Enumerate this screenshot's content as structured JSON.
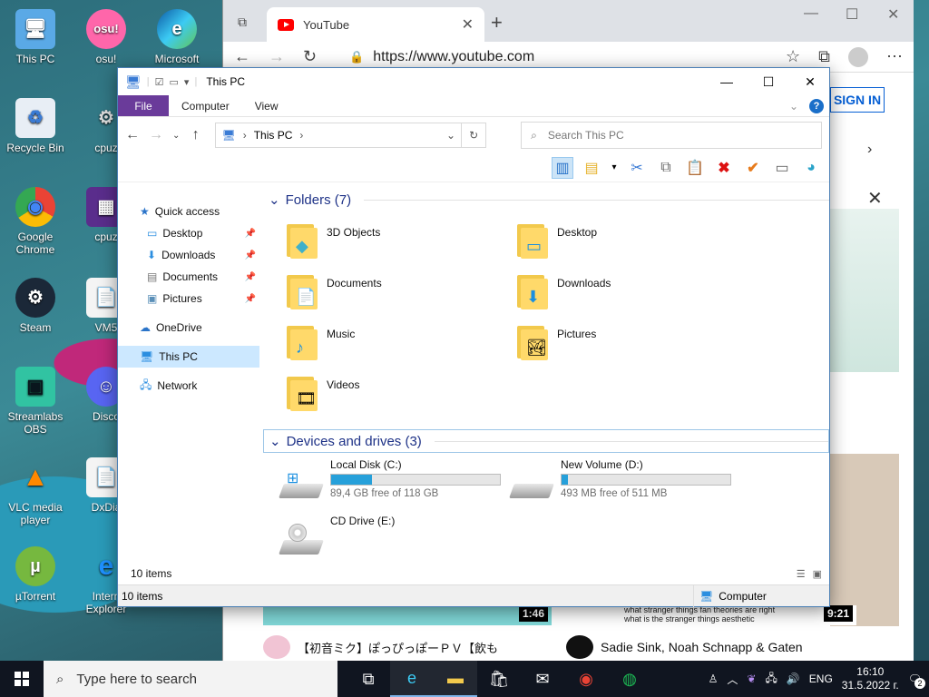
{
  "desktop": {
    "icons": [
      {
        "label": "This PC",
        "glyph": "🖥"
      },
      {
        "label": "Recycle Bin",
        "glyph": "♻"
      },
      {
        "label": "Google Chrome",
        "glyph": "◉"
      },
      {
        "label": "Steam",
        "glyph": "⚙"
      },
      {
        "label": "Streamlabs OBS",
        "glyph": "▣"
      },
      {
        "label": "VLC media player",
        "glyph": "▲"
      },
      {
        "label": "µTorrent",
        "glyph": "µ"
      },
      {
        "label": "osu!",
        "glyph": "osu!"
      },
      {
        "label": "Microsoft",
        "glyph": "e"
      },
      {
        "label": "cpuz",
        "glyph": "⚙"
      },
      {
        "label": "cpuz",
        "glyph": "▦"
      },
      {
        "label": "VM5",
        "glyph": "📄"
      },
      {
        "label": "Disco",
        "glyph": "☺"
      },
      {
        "label": "DxDia",
        "glyph": "📄"
      },
      {
        "label": "Intern Explorer",
        "glyph": "e"
      }
    ]
  },
  "browser": {
    "tab_title": "YouTube",
    "url": "https://www.youtube.com",
    "sign_in": "SIGN IN",
    "video_durations": [
      "1:46",
      "9:21"
    ],
    "video_titles": [
      "【初音ミク】ぽっぴっぽーＰＶ【飲も",
      "Sadie Sink, Noah Schnapp & Gaten"
    ],
    "thumb_caption_1": "what stranger things fan theories are right",
    "thumb_caption_2": "what is the stranger things aesthetic"
  },
  "explorer": {
    "title": "This PC",
    "ribbon_tabs": {
      "file": "File",
      "computer": "Computer",
      "view": "View"
    },
    "address": {
      "root": "This PC"
    },
    "search_placeholder": "Search This PC",
    "sidebar": {
      "quick_access": "Quick access",
      "desktop": "Desktop",
      "downloads": "Downloads",
      "documents": "Documents",
      "pictures": "Pictures",
      "onedrive": "OneDrive",
      "this_pc": "This PC",
      "network": "Network"
    },
    "folders_header": "Folders (7)",
    "folders": [
      {
        "name": "3D Objects",
        "badge": "◆"
      },
      {
        "name": "Desktop",
        "badge": "▭"
      },
      {
        "name": "Documents",
        "badge": "📄"
      },
      {
        "name": "Downloads",
        "badge": "⬇"
      },
      {
        "name": "Music",
        "badge": "♪"
      },
      {
        "name": "Pictures",
        "badge": "🏞"
      },
      {
        "name": "Videos",
        "badge": "🎞"
      }
    ],
    "drives_header": "Devices and drives (3)",
    "drives": [
      {
        "name": "Local Disk (C:)",
        "free": "89,4 GB free of 118 GB",
        "used_fraction": 0.24
      },
      {
        "name": "New Volume (D:)",
        "free": "493 MB free of 511 MB",
        "used_fraction": 0.04
      },
      {
        "name": "CD Drive (E:)",
        "free": "",
        "used_fraction": null
      }
    ],
    "item_count": "10 items",
    "status_items": "10 items",
    "status_computer": "Computer"
  },
  "taskbar": {
    "search_placeholder": "Type here to search",
    "lang": "ENG",
    "time": "16:10",
    "date": "31.5.2022 г.",
    "notifications": "2"
  }
}
